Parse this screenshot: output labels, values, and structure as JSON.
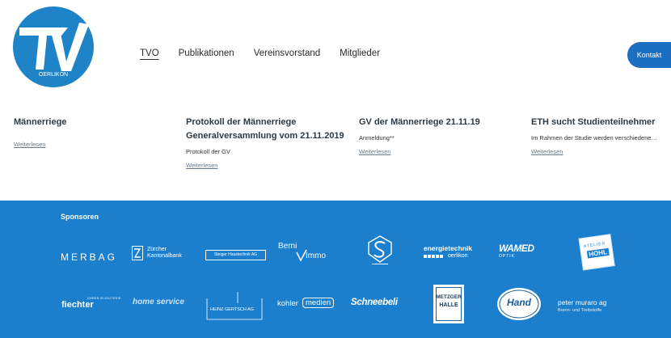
{
  "header": {
    "logo_text": "OERLIKON",
    "nav": [
      "TVO",
      "Publikationen",
      "Vereinsvorstand",
      "Mitglieder"
    ],
    "contact_label": "Kontakt"
  },
  "news": [
    {
      "title": "Männerriege",
      "text": "",
      "link": "Weiterlesen"
    },
    {
      "title": "Protokoll der Männerriege Generalversammlung vom 21.11.2019",
      "text": "Protokoll der GV",
      "link": "Weiterlesen"
    },
    {
      "title": "GV der Männerriege 21.11.19",
      "text": "Anmeldung**",
      "link": "Weiterlesen"
    },
    {
      "title": "ETH sucht Studienteilnehmer",
      "text": "Im Rahmen der Studie werden verschiedene…",
      "link": "Weiterlesen"
    }
  ],
  "footer": {
    "sponsors_title": "Sponsoren",
    "sponsors": {
      "merbag": "MERBAG",
      "zkb": "Zürcher Kantonalbank",
      "steiger": "Steiger Haustechnik AG",
      "berni_a": "Berni",
      "berni_b": "Immo",
      "energie_a": "energietechnik",
      "energie_b": "oerlikon",
      "wamed": "WAMED",
      "wamed_sub": "OPTIK",
      "atelier_a": "ATELIER",
      "atelier_b": "HOHL",
      "fiechter_small": "UHREN BIJOUTERIE",
      "fiechter": "fiechter",
      "homeservice": "home service",
      "gertsch": "HEINZ GERTSCH AG",
      "kohler_a": "kohler",
      "kohler_b": "medien",
      "schneebeli": "Schneebeli",
      "metzger_a": "METZGER",
      "metzger_b": "HALLE",
      "hand": "Hand",
      "muraro": "peter muraro ag",
      "muraro_sub": "Brenn- und Treibstoffe"
    }
  },
  "colors": {
    "brand_blue": "#1b7fce",
    "button_blue": "#1a6fc2",
    "logo_blue": "#1f83c7"
  }
}
